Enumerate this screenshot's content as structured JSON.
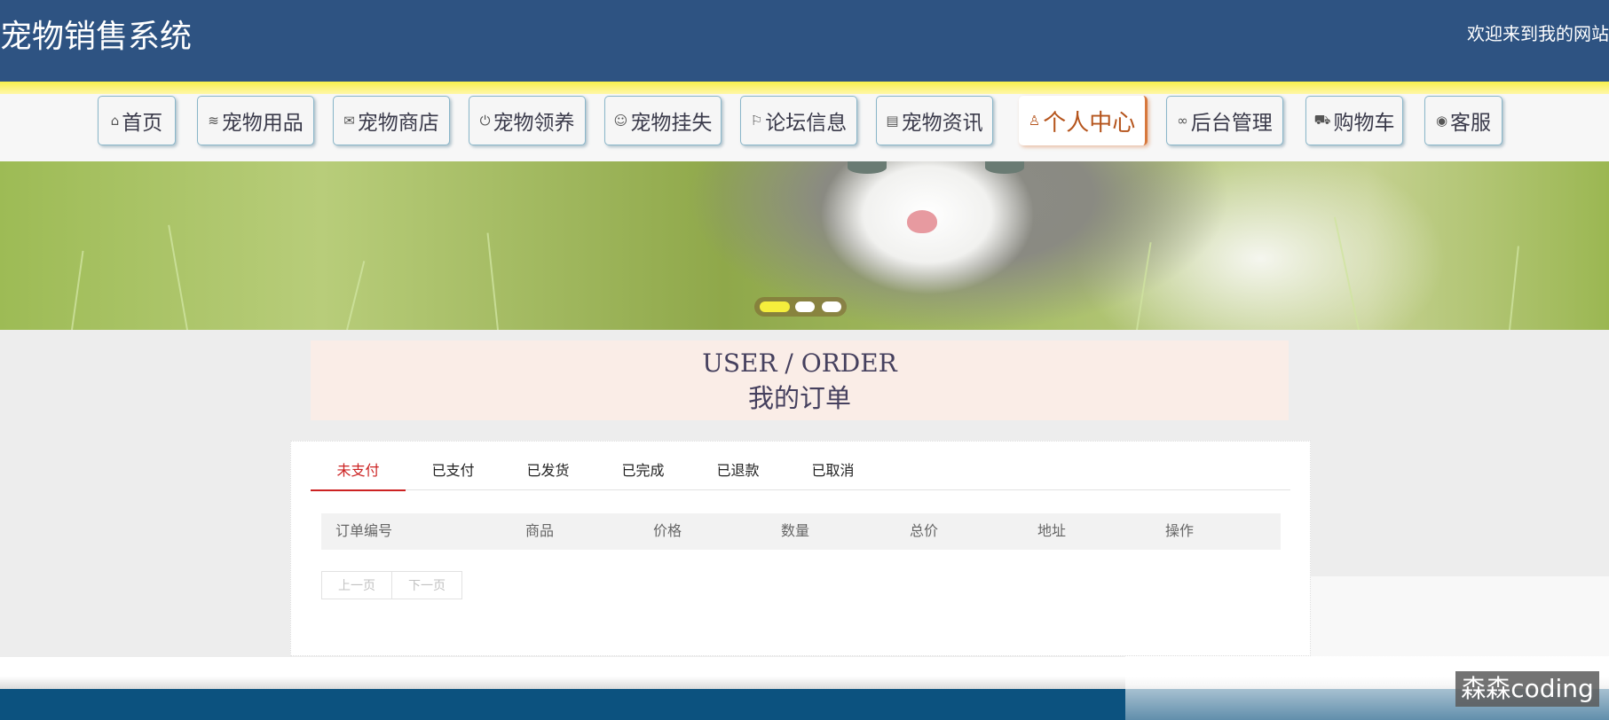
{
  "header": {
    "site_title": "宠物销售系统",
    "welcome": "欢迎来到我的网站"
  },
  "nav": {
    "items": [
      {
        "label": "首页",
        "icon": "home-icon",
        "glyph": "⌂"
      },
      {
        "label": "宠物用品",
        "icon": "layers-icon",
        "glyph": "≋"
      },
      {
        "label": "宠物商店",
        "icon": "mail-icon",
        "glyph": "✉"
      },
      {
        "label": "宠物领养",
        "icon": "power-icon",
        "glyph": "⏻"
      },
      {
        "label": "宠物挂失",
        "icon": "palette-icon",
        "glyph": "☺"
      },
      {
        "label": "论坛信息",
        "icon": "flag-icon",
        "glyph": "⚐"
      },
      {
        "label": "宠物资讯",
        "icon": "clipboard-icon",
        "glyph": "▤"
      },
      {
        "label": "个人中心",
        "icon": "user-icon",
        "glyph": "♙"
      },
      {
        "label": "后台管理",
        "icon": "link-icon",
        "glyph": "∞"
      },
      {
        "label": "购物车",
        "icon": "cart-icon",
        "glyph": "⛟"
      },
      {
        "label": "客服",
        "icon": "chat-icon",
        "glyph": "◉"
      }
    ],
    "active_index": 7
  },
  "banner": {
    "slide_count": 3,
    "active_slide": 0
  },
  "page_title": {
    "en": "USER / ORDER",
    "zh": "我的订单"
  },
  "tabs": [
    "未支付",
    "已支付",
    "已发货",
    "已完成",
    "已退款",
    "已取消"
  ],
  "active_tab": 0,
  "table": {
    "columns": [
      "订单编号",
      "商品",
      "价格",
      "数量",
      "总价",
      "地址",
      "操作"
    ],
    "rows": []
  },
  "pager": {
    "prev": "上一页",
    "next": "下一页"
  },
  "watermark": "森森coding",
  "colors": {
    "header_bg": "#2e5382",
    "active_nav": "#b5541c",
    "active_tab": "#cc2222",
    "footer_bg": "#0c527f"
  }
}
